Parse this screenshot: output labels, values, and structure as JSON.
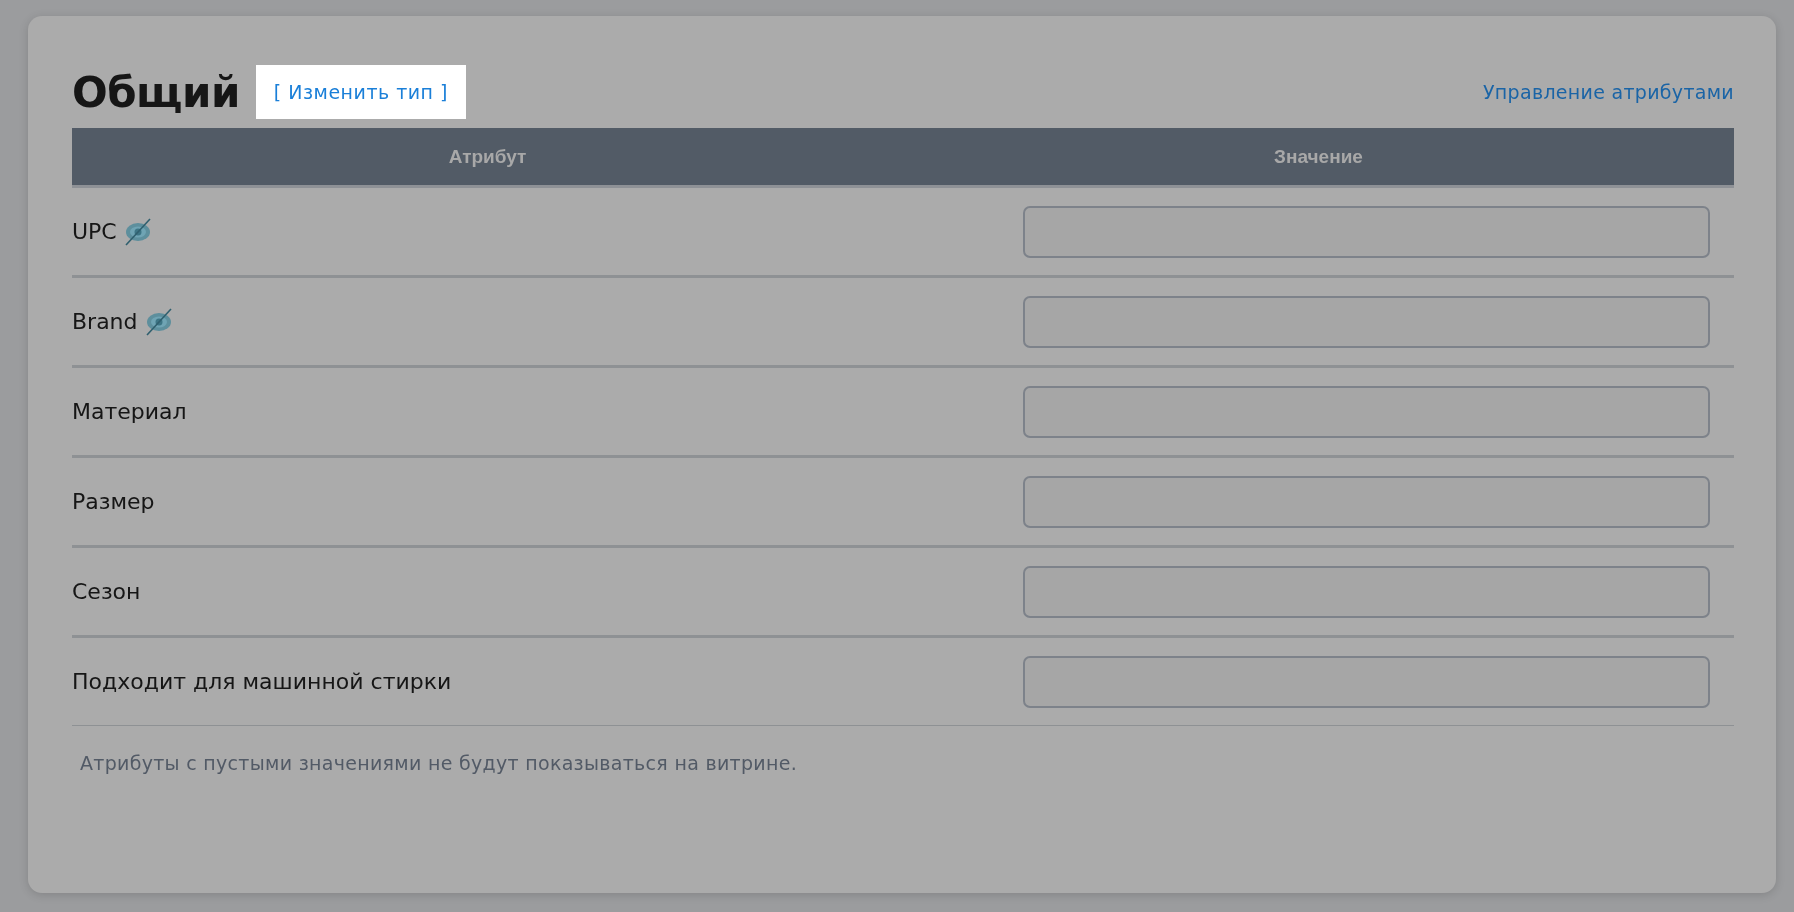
{
  "title": "Общий",
  "change_type_link": "[ Изменить тип ]",
  "manage_link": "Управление атрибутами",
  "table": {
    "columns": [
      "Атрибут",
      "Значение"
    ],
    "rows": [
      {
        "name": "UPC",
        "hidden": true,
        "value": ""
      },
      {
        "name": "Brand",
        "hidden": true,
        "value": ""
      },
      {
        "name": "Материал",
        "hidden": false,
        "value": ""
      },
      {
        "name": "Размер",
        "hidden": false,
        "value": ""
      },
      {
        "name": "Сезон",
        "hidden": false,
        "value": ""
      },
      {
        "name": "Подходит для машинной стирки",
        "hidden": false,
        "value": ""
      }
    ]
  },
  "note": "Атрибуты с пустыми значениями не будут показываться на витрине."
}
